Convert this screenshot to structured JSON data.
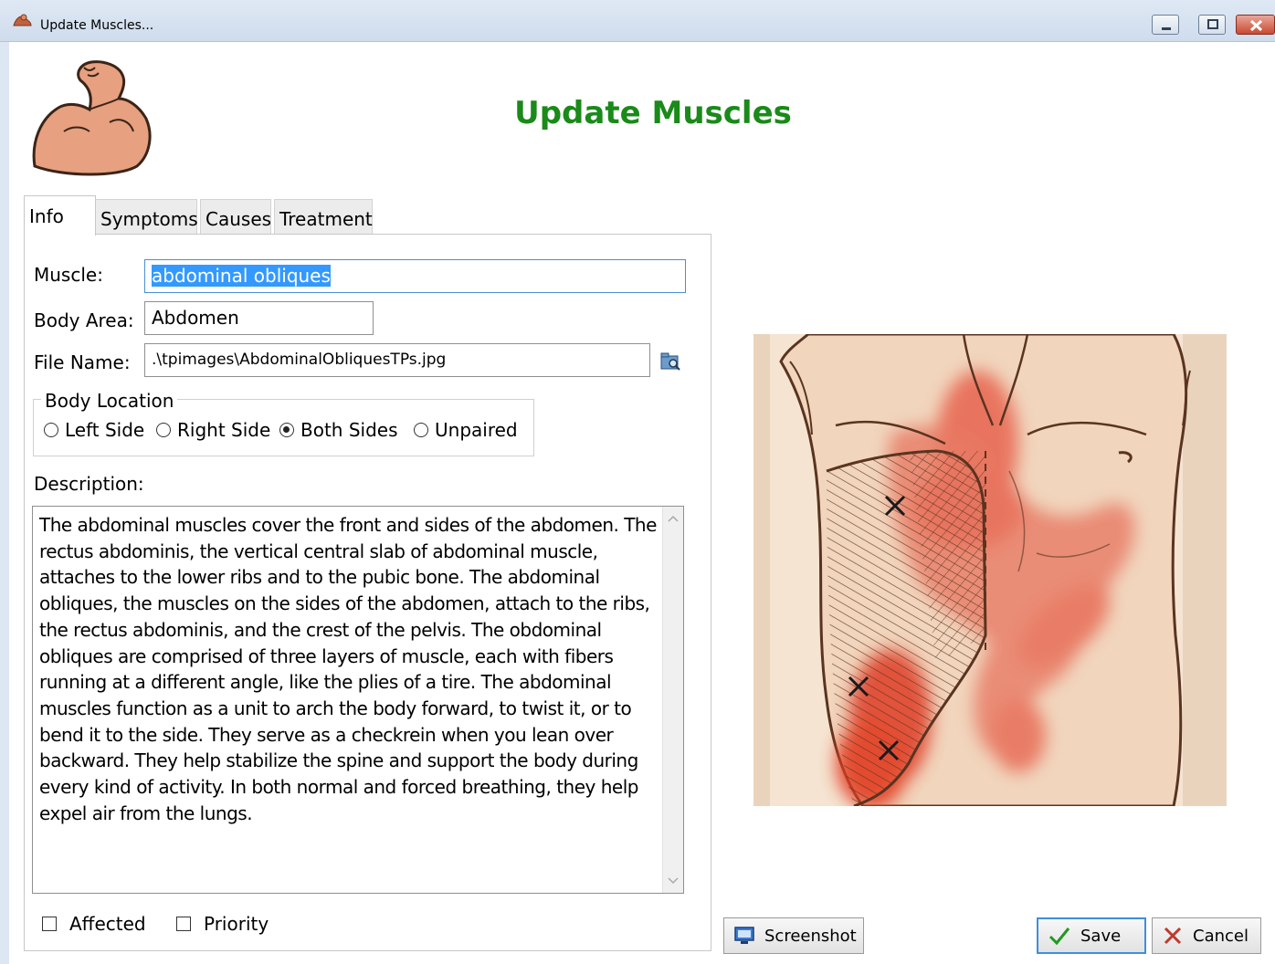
{
  "window": {
    "title": "Update Muscles...",
    "controls": [
      "minimize-icon",
      "maximize-icon",
      "close-icon"
    ]
  },
  "header": {
    "title": "Update Muscles",
    "title_color": "#1a8a1a",
    "logo_icon": "flexed-arm-icon"
  },
  "tabs": [
    {
      "label": "Info",
      "active": true
    },
    {
      "label": "Symptoms",
      "active": false
    },
    {
      "label": "Causes",
      "active": false
    },
    {
      "label": "Treatment",
      "active": false
    }
  ],
  "form": {
    "muscle_label": "Muscle:",
    "muscle_value": "abdominal obliques",
    "body_area_label": "Body Area:",
    "body_area_value": "Abdomen",
    "file_name_label": "File Name:",
    "file_name_value": ".\\tpimages\\AbdominalObliquesTPs.jpg",
    "browse_icon": "folder-browse-icon",
    "body_location": {
      "title": "Body Location",
      "options": [
        {
          "label": "Left Side",
          "selected": false
        },
        {
          "label": "Right Side",
          "selected": false
        },
        {
          "label": "Both Sides",
          "selected": true
        },
        {
          "label": "Unpaired",
          "selected": false
        }
      ]
    },
    "description_label": "Description:",
    "description": "The abdominal muscles cover the front and sides of the abdomen. The rectus abdominis, the vertical central slab of abdominal muscle, attaches to the lower ribs and to the pubic bone. The abdominal obliques, the muscles on the sides of the abdomen, attach to the ribs, the rectus abdominis, and the crest of the pelvis. The obdominal obliques are comprised of three layers of muscle, each with fibers running at a different angle, like the plies of a tire. The abdominal muscles function as a unit to arch the body forward, to twist it, or to bend it to the side. They serve as a checkrein when you lean over backward. They help stabilize the spine and support the body during every kind of activity. In both normal and forced breathing, they help expel air from the lungs.",
    "affected": {
      "label": "Affected",
      "checked": false
    },
    "priority": {
      "label": "Priority",
      "checked": false
    }
  },
  "buttons": {
    "screenshot": "Screenshot",
    "save": "Save",
    "cancel": "Cancel"
  },
  "colors": {
    "accent": "#3399ff",
    "save_check": "#1f9a1f",
    "cancel_x": "#c0392b",
    "pain_red": "#e2533d"
  }
}
